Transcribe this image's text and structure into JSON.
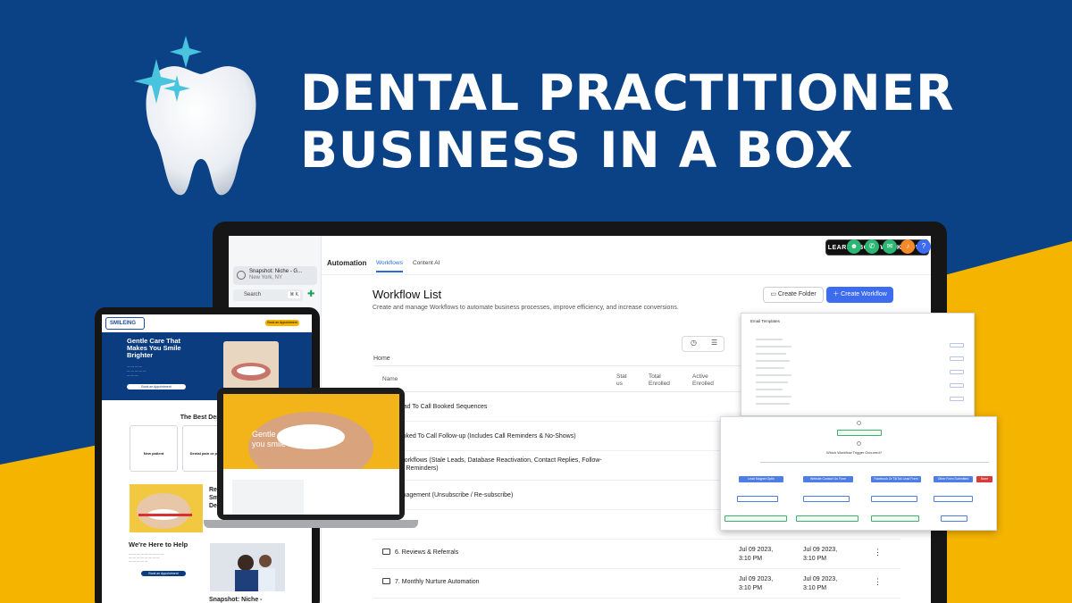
{
  "headline": {
    "line1": "DENTAL PRACTITIONER",
    "line2": "BUSINESS IN A BOX"
  },
  "colors": {
    "background_blue": "#0b4185",
    "accent_yellow": "#f5b400",
    "primary_button": "#3d6cf0"
  },
  "app": {
    "snapshot": {
      "title": "Snapshot: Niche - G...",
      "location": "New York, NY"
    },
    "search": {
      "placeholder": "Search",
      "shortcut": "⌘ K"
    },
    "learn_button": "LEARN ABOUT WORKFLOWS",
    "top_icons": [
      "users-icon",
      "phone-icon",
      "megaphone-icon",
      "bell-icon",
      "help-icon"
    ],
    "section": "Automation",
    "tabs": [
      {
        "label": "Workflows",
        "active": true
      },
      {
        "label": "Content AI",
        "active": false
      }
    ],
    "page_title": "Workflow List",
    "page_description": "Create and manage Workflows to automate business processes, improve efficiency, and increase conversions.",
    "create_folder": "Create Folder",
    "create_workflow": "Create Workflow",
    "breadcrumb": "Home",
    "columns": [
      "Name",
      "Stat us",
      "Total Enrolled",
      "Active Enrolled"
    ],
    "rows": [
      {
        "name": "New Lead To Call Booked Sequences",
        "date1": "",
        "date2": ""
      },
      {
        "name": "Call Booked To Call Follow-up (Includes Call Reminders & No-Shows)",
        "date1": "",
        "date2": ""
      },
      {
        "name": "Misc. Workflows (Stale Leads, Database Reactivation, Contact Replies, Follow-up Date Reminders)",
        "date1": "",
        "date2": ""
      },
      {
        "name": "List Management (Unsubscribe / Re-subscribe)",
        "date1": "",
        "date2": ""
      },
      {
        "name": "ing",
        "date1": "",
        "date2": ""
      },
      {
        "name": "6. Reviews & Referrals",
        "date1": "Jul 09 2023, 3:10 PM",
        "date2": "Jul 09 2023, 3:10 PM"
      },
      {
        "name": "7. Monthly Nurture Automation",
        "date1": "Jul 09 2023, 3:10 PM",
        "date2": "Jul 09 2023, 3:10 PM"
      }
    ]
  },
  "tablet": {
    "logo": "SMILEING",
    "book_button": "Book an Appointment",
    "hero_title": "Gentle Care That Makes You Smile Brighter",
    "hero_cta": "Book an Appointment",
    "best": "The Best Dental E",
    "cards": [
      "New patient",
      "Dental pain or prob"
    ],
    "nearby": "Re Sm De",
    "here": "We're Here to Help",
    "help_cta": "Book an Appointment",
    "snapshot_caption": "Snapshot: Niche -"
  },
  "laptop": {
    "hero_text": "Gentle care that makes you smile brighter."
  },
  "email_card": {
    "title": "Email Templates"
  },
  "flow_card": {
    "trigger": "Which Workflow Trigger Occurred?",
    "branches": [
      "Lead Magnet Optin",
      "Website Contact Us Form",
      "Facebook Or TikTok Lead Form",
      "Other Form Submitted"
    ],
    "none": "None"
  }
}
